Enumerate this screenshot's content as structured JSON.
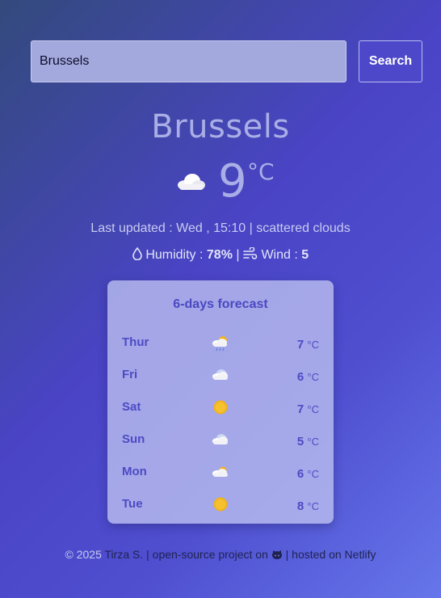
{
  "search": {
    "value": "Brussels",
    "button_label": "Search"
  },
  "current": {
    "city": "Brussels",
    "temperature": "9",
    "unit": "°C",
    "icon": "cloud-icon",
    "last_updated": "Last updated : Wed , 15:10 | scattered clouds",
    "humidity_label": "Humidity :",
    "humidity_value": "78%",
    "separator": "|",
    "wind_label": "Wind :",
    "wind_value": "5"
  },
  "forecast": {
    "title": "6-days forecast",
    "unit": "°C",
    "days": [
      {
        "day": "Thur",
        "temp": "7",
        "icon": "cloud-sun-rain-icon"
      },
      {
        "day": "Fri",
        "temp": "6",
        "icon": "cloud-icon"
      },
      {
        "day": "Sat",
        "temp": "7",
        "icon": "sun-icon"
      },
      {
        "day": "Sun",
        "temp": "5",
        "icon": "cloud-icon"
      },
      {
        "day": "Mon",
        "temp": "6",
        "icon": "cloud-sun-icon"
      },
      {
        "day": "Tue",
        "temp": "8",
        "icon": "sun-icon"
      }
    ]
  },
  "footer": {
    "copyright": "© 2025",
    "author": "Tirza S.",
    "sep1": "|",
    "project_text": "open-source project on",
    "github_icon": "github-icon",
    "sep2": "|",
    "hosted_text": "hosted on Netlify"
  },
  "colors": {
    "accent": "#4d47c9",
    "forecast_text": "#4d4ac4",
    "sun": "#f2b21b"
  }
}
